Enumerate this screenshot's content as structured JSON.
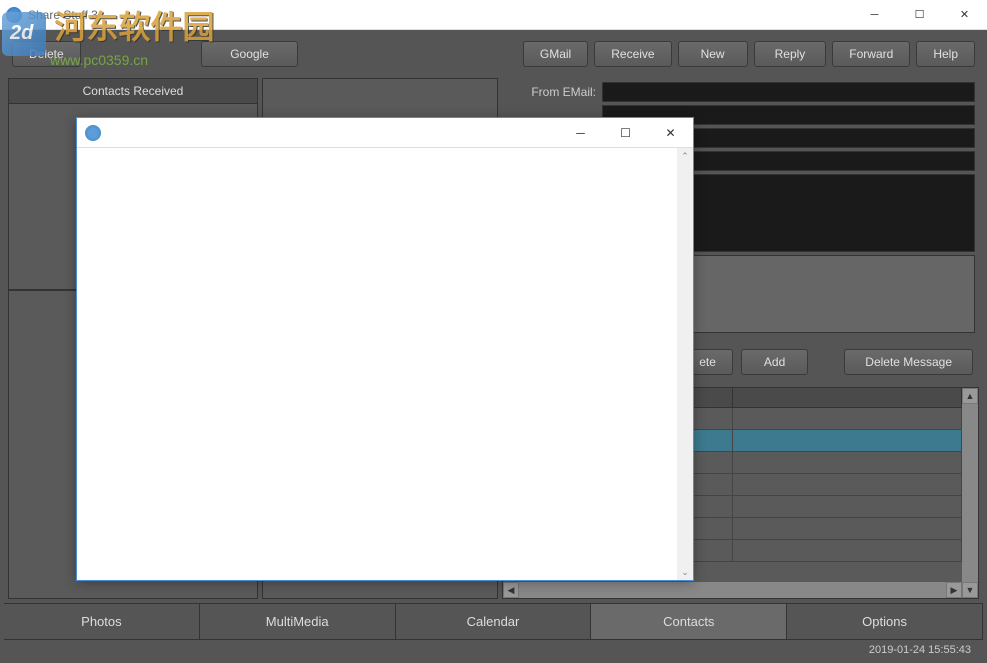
{
  "window": {
    "title": "Share Stuff 3"
  },
  "watermark": {
    "text": "河东软件园",
    "url": "www.pc0359.cn"
  },
  "toolbar": {
    "delete": "Delete",
    "google": "Google",
    "gmail": "GMail",
    "receive": "Receive",
    "new": "New",
    "reply": "Reply",
    "forward": "Forward",
    "help": "Help"
  },
  "leftPanel": {
    "header": "Contacts Received"
  },
  "form": {
    "fromEmailLabel": "From EMail:",
    "fromEmailValue": "",
    "field2": "",
    "field3": "",
    "field4": ""
  },
  "actions": {
    "partialDelete": "ete",
    "add": "Add",
    "deleteMessage": "Delete Message"
  },
  "tabs": {
    "photos": "Photos",
    "multimedia": "MultiMedia",
    "calendar": "Calendar",
    "contacts": "Contacts",
    "options": "Options"
  },
  "statusBar": {
    "timestamp": "2019-01-24 15:55:43"
  },
  "modal": {
    "title": ""
  }
}
